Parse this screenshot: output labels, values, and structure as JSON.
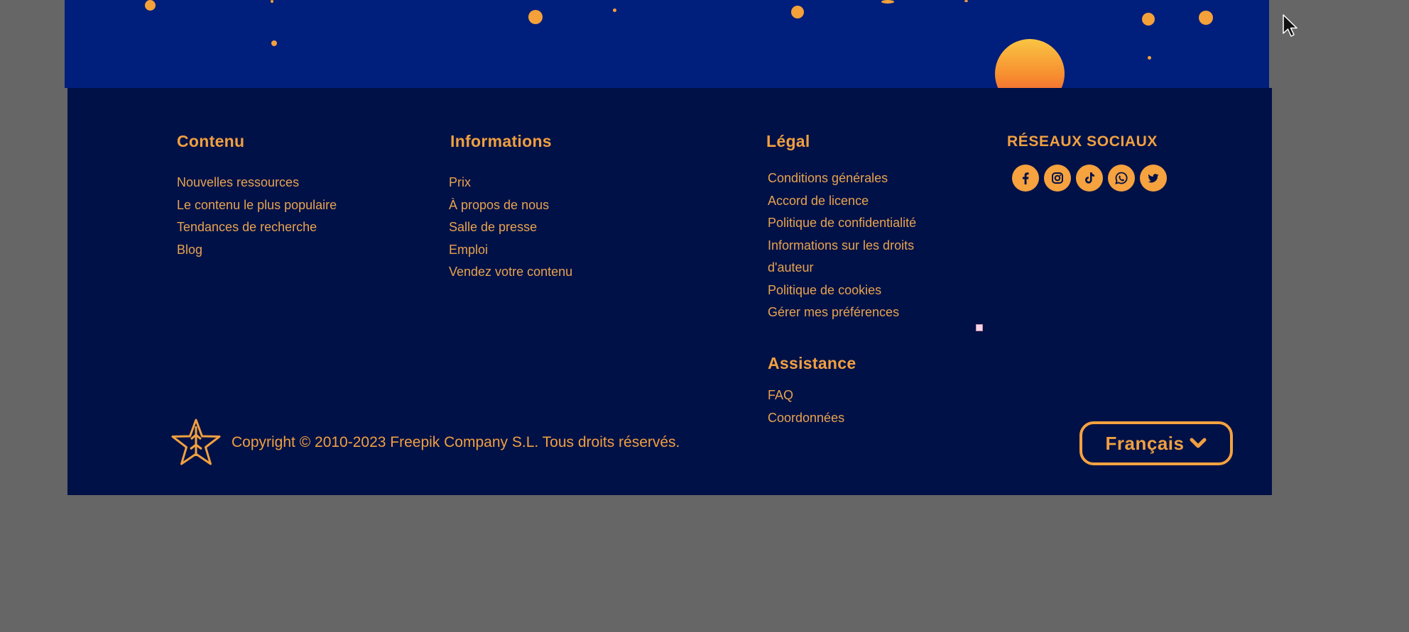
{
  "colors": {
    "background": "#666667",
    "banner": "#001e7c",
    "footer": "#001147",
    "accent": "#f0a040"
  },
  "columns": {
    "contenu": {
      "title": "Contenu",
      "links": [
        "Nouvelles ressources",
        "Le contenu le plus populaire",
        "Tendances de recherche",
        "Blog"
      ]
    },
    "informations": {
      "title": "Informations",
      "links": [
        "Prix",
        "À propos de nous",
        "Salle de presse",
        "Emploi",
        "Vendez votre contenu"
      ]
    },
    "legal": {
      "title": "Légal",
      "links": [
        "Conditions générales",
        "Accord de licence",
        "Politique de confidentialité",
        "Informations sur les droits",
        "d'auteur",
        "Politique de cookies",
        "Gérer mes préférences"
      ]
    },
    "assistance": {
      "title": "Assistance",
      "links": [
        "FAQ",
        "Coordonnées"
      ]
    },
    "social": {
      "title": "RÉSEAUX SOCIAUX",
      "icons": [
        "facebook-icon",
        "instagram-icon",
        "tiktok-icon",
        "whatsapp-icon",
        "twitter-icon"
      ]
    }
  },
  "copyright": "Copyright ©  2010-2023 Freepik Company S.L. Tous droits réservés.",
  "language": {
    "selected": "Français",
    "icon": "chevron-down-icon"
  }
}
